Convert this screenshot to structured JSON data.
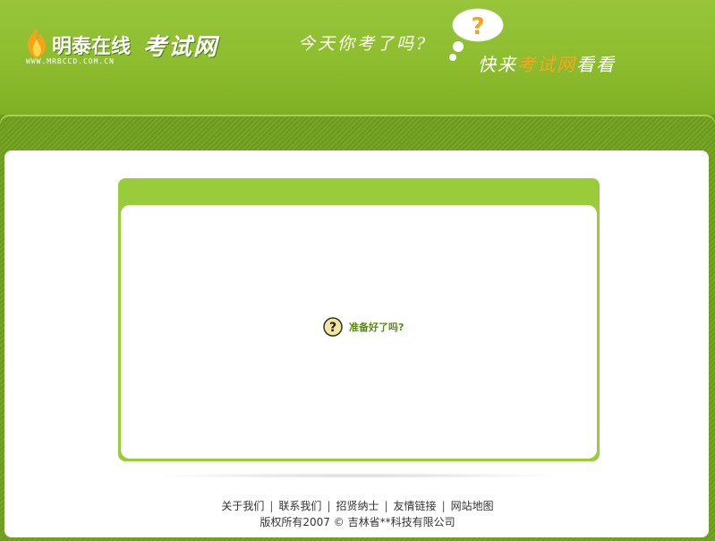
{
  "header": {
    "logo_cn": "明泰在线",
    "logo_kaoshi": "考试网",
    "logo_url": "WWW.MRBCCD.COM.CN",
    "slogan1": "今天你考了吗?",
    "slogan2_pre": "快来",
    "slogan2_hl": "考试网",
    "slogan2_post": "看看",
    "bubble_icon": "question-bubble-icon"
  },
  "main": {
    "question_text": "准备好了吗?",
    "question_icon": "question-mark-icon"
  },
  "footer": {
    "links": [
      "关于我们",
      "联系我们",
      "招贤纳士",
      "友情链接",
      "网站地图"
    ],
    "separator": "|",
    "copyright": "版权所有2007 © 吉林省**科技有限公司"
  },
  "colors": {
    "header_green": "#8cbc2e",
    "panel_green": "#9acb3a",
    "text_green": "#5a8a0c",
    "accent_orange": "#ffa31a"
  }
}
